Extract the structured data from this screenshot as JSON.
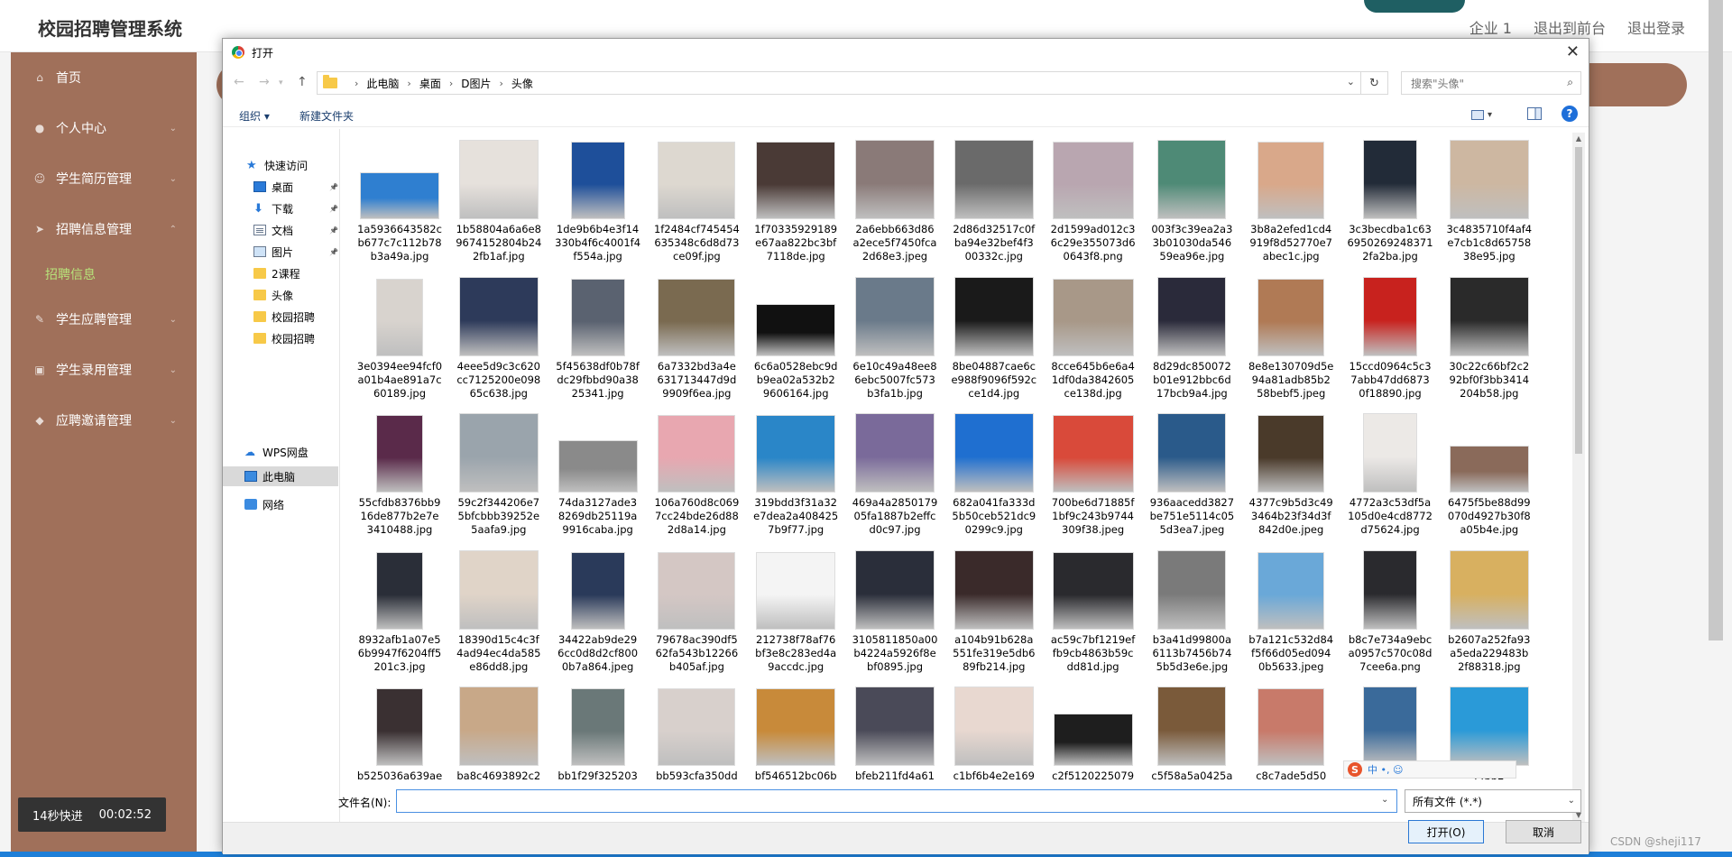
{
  "app": {
    "title": "校园招聘管理系统",
    "header_links": [
      "企业 1",
      "退出到前台",
      "退出登录"
    ],
    "sidebar": [
      {
        "label": "首页",
        "icon": "home-icon",
        "sub": []
      },
      {
        "label": "个人中心",
        "icon": "user-icon",
        "sub": []
      },
      {
        "label": "学生简历管理",
        "icon": "resume-icon",
        "sub": []
      },
      {
        "label": "招聘信息管理",
        "icon": "recruit-icon",
        "sub": [
          "招聘信息"
        ]
      },
      {
        "label": "学生应聘管理",
        "icon": "apply-icon",
        "sub": []
      },
      {
        "label": "学生录用管理",
        "icon": "hire-icon",
        "sub": []
      },
      {
        "label": "应聘邀请管理",
        "icon": "invite-icon",
        "sub": []
      }
    ],
    "timer": {
      "label": "14秒快进",
      "time": "00:02:52"
    },
    "watermark": "CSDN @sheji117",
    "colors": {
      "sidebar": "#a0705a",
      "accent_green": "#b7e27a"
    }
  },
  "dialog": {
    "title": "打开",
    "breadcrumb": [
      "此电脑",
      "桌面",
      "D图片",
      "头像"
    ],
    "search_placeholder": "搜索\"头像\"",
    "toolbar": {
      "organize": "组织 ▾",
      "new_folder": "新建文件夹",
      "help": "?"
    },
    "nav": {
      "quick_access": "快速访问",
      "items": [
        {
          "label": "桌面",
          "icon": "desktop-icon",
          "pinned": true
        },
        {
          "label": "下载",
          "icon": "download-icon",
          "pinned": true
        },
        {
          "label": "文档",
          "icon": "document-icon",
          "pinned": true
        },
        {
          "label": "图片",
          "icon": "pictures-icon",
          "pinned": true
        },
        {
          "label": "2课程",
          "icon": "folder-icon",
          "pinned": false
        },
        {
          "label": "头像",
          "icon": "folder-icon",
          "pinned": false
        },
        {
          "label": "校园招聘",
          "icon": "folder-icon",
          "pinned": false
        },
        {
          "label": "校园招聘",
          "icon": "folder-icon",
          "pinned": false
        }
      ],
      "wps": "WPS网盘",
      "this_pc": "此电脑",
      "network": "网络"
    },
    "files": [
      {
        "name": "1a5936643582c\nb677c7c112b78\nb3a49a.jpg",
        "bg": "#2f7fd0"
      },
      {
        "name": "1b58804a6a6e8\n9674152804b24\n2fb1af.jpg",
        "bg": "#e6e1dc"
      },
      {
        "name": "1de9b6b4e3f14\n330b4f6c4001f4\nf554a.jpg",
        "bg": "#1e4f9a"
      },
      {
        "name": "1f2484cf745454\n635348c6d8d73\nce09f.jpg",
        "bg": "#ddd8d0"
      },
      {
        "name": "1f70335929189\ne67aa822bc3bf\n7118de.jpg",
        "bg": "#4a3a36"
      },
      {
        "name": "2a6ebb663d86\na2ece5f7450fca\n2d68e3.jpeg",
        "bg": "#8a7a78"
      },
      {
        "name": "2d86d32517c0f\nba94e32bef4f3\n00332c.jpg",
        "bg": "#6a6a6a"
      },
      {
        "name": "2d1599ad012c3\n6c29e355073d6\n0643f8.png",
        "bg": "#b9a6b0"
      },
      {
        "name": "003f3c39ea2a3\n3b01030da546\n59ea96e.jpg",
        "bg": "#4e8a76"
      },
      {
        "name": "3b8a2efed1cd4\n919f8d52770e7\nabec1c.jpg",
        "bg": "#d9a88a"
      },
      {
        "name": "3c3becdba1c63\n6950269248371\n2fa2ba.jpg",
        "bg": "#222b38"
      },
      {
        "name": "3c4835710f4af4\ne7cb1c8d65758\n38e95.jpg",
        "bg": "#cdb7a1"
      },
      {
        "name": "3e0394ee94fcf0\na01b4ae891a7c\n60189.jpg",
        "bg": "#d8d3ce"
      },
      {
        "name": "4eee5d9c3c620\ncc7125200e098\n65c638.jpg",
        "bg": "#2d3a5a"
      },
      {
        "name": "5f45638df0b78f\ndc29fbbd90a38\n25341.jpg",
        "bg": "#5a6270"
      },
      {
        "name": "6a7332bd3a4e\n631713447d9d\n9909f6ea.jpg",
        "bg": "#7a6a50"
      },
      {
        "name": "6c6a0528ebc9d\nb9ea02a532b2\n9606164.jpg",
        "bg": "#111111"
      },
      {
        "name": "6e10c49a48ee8\n6ebc5007fc573\nb3fa1b.jpg",
        "bg": "#6a7a8a"
      },
      {
        "name": "8be04887cae6c\ne988f9096f592c\nce1d4.jpg",
        "bg": "#1a1a1a"
      },
      {
        "name": "8cce645b6e6a4\n1df0da3842605\nce138d.jpg",
        "bg": "#a89888"
      },
      {
        "name": "8d29dc850072\nb01e912bbc6d\n17bcb9a4.jpg",
        "bg": "#2a2a3a"
      },
      {
        "name": "8e8e130709d5e\n94a81adb85b2\n58bebf5.jpeg",
        "bg": "#b07a55"
      },
      {
        "name": "15ccd0964c5c3\n7abb47dd6873\n0f18890.jpg",
        "bg": "#c8221e"
      },
      {
        "name": "30c22c66bf2c2\n92bf0f3bb3414\n204b58.jpg",
        "bg": "#2a2a2a"
      },
      {
        "name": "55cfdb8376bb9\n16de877b2e7e\n3410488.jpg",
        "bg": "#5a2a4a"
      },
      {
        "name": "59c2f344206e7\n5bfcbbb39252e\n5aafa9.jpg",
        "bg": "#9aa4ac"
      },
      {
        "name": "74da3127ade3\n8269db25119a\n9916caba.jpg",
        "bg": "#8a8a8a"
      },
      {
        "name": "106a760d8c069\n7cc24bde26d88\n2d8a14.jpg",
        "bg": "#e8a7b0"
      },
      {
        "name": "319bdd3f31a32\ne7dea2a408425\n7b9f77.jpg",
        "bg": "#2a86c8"
      },
      {
        "name": "469a4a2850179\n05fa1887b2effc\nd0c97.jpg",
        "bg": "#7a6a9a"
      },
      {
        "name": "682a041fa333d\n5b50ceb521dc9\n0299c9.jpg",
        "bg": "#1f6fd0"
      },
      {
        "name": "700be6d71885f\n1bf9c243b9744\n309f38.jpeg",
        "bg": "#d94a3a"
      },
      {
        "name": "936aacedd3827\nbe751e5114c05\n5d3ea7.jpeg",
        "bg": "#2a5a8a"
      },
      {
        "name": "4377c9b5d3c49\n3464b23f34d3f\n842d0e.jpeg",
        "bg": "#4a3a2a"
      },
      {
        "name": "4772a3c53df5a\n105d0e4cd8772\nd75624.jpg",
        "bg": "#ece9e6"
      },
      {
        "name": "6475f5be88d99\n070d4927b30f8\na05b4e.jpg",
        "bg": "#8a6a5a"
      },
      {
        "name": "8932afb1a07e5\n6b9947f6204ff5\n201c3.jpg",
        "bg": "#2a2e38"
      },
      {
        "name": "18390d15c4c3f\n4ad94ec4da585\ne86dd8.jpg",
        "bg": "#e0d4c8"
      },
      {
        "name": "34422ab9de29\n6cc0d8d2cf800\n0b7a864.jpeg",
        "bg": "#2a3a5a"
      },
      {
        "name": "79678ac390df5\n62fa543b12266\nb405af.jpg",
        "bg": "#d4c7c4"
      },
      {
        "name": "212738f78af76\nbf3e8c283ed4a\n9accdc.jpg",
        "bg": "#f4f4f4"
      },
      {
        "name": "3105811850a00\nb4224a5926f8e\nbf0895.jpg",
        "bg": "#2a2e3a"
      },
      {
        "name": "a104b91b628a\n551fe319e5db6\n89fb214.jpg",
        "bg": "#3a2a2a"
      },
      {
        "name": "ac59c7bf1219ef\nfb9cb4863b59c\ndd81d.jpg",
        "bg": "#2a2a2e"
      },
      {
        "name": "b3a41d99800a\n6113b7456b74\n5b5d3e6e.jpg",
        "bg": "#7a7a7a"
      },
      {
        "name": "b7a121c532d84\nf5f66d05ed094\n0b5633.jpeg",
        "bg": "#6aa8d8"
      },
      {
        "name": "b8c7e734a9ebc\na0957c570c08d\n7cee6a.png",
        "bg": "#2a2a2e"
      },
      {
        "name": "b2607a252fa93\na5eda229483b\n2f88318.jpg",
        "bg": "#d8b060"
      },
      {
        "name": "b525036a639ae",
        "bg": "#3a3032"
      },
      {
        "name": "ba8c4693892c2",
        "bg": "#c8a888"
      },
      {
        "name": "bb1f29f325203",
        "bg": "#6a7878"
      },
      {
        "name": "bb593cfa350dd",
        "bg": "#d8d0cc"
      },
      {
        "name": "bf546512bc06b",
        "bg": "#c88a3a"
      },
      {
        "name": "bfeb211fd4a61",
        "bg": "#4a4a58"
      },
      {
        "name": "c1bf6b4e2e169",
        "bg": "#e8d8d0"
      },
      {
        "name": "c2f5120225079",
        "bg": "#1e1e1e"
      },
      {
        "name": "c5f58a5a0425a",
        "bg": "#7a5a3a"
      },
      {
        "name": "c8c7ade5d50",
        "bg": "#c87a6a"
      },
      {
        "name": "",
        "bg": "#3a6a9a"
      },
      {
        "name": "f4bb2",
        "bg": "#2a9ad8"
      }
    ],
    "filename_label": "文件名(N):",
    "filename_value": "",
    "file_type": "所有文件 (*.*)",
    "open_button": "打开(O)",
    "cancel_button": "取消",
    "ime_text": "中 •, ☺"
  }
}
